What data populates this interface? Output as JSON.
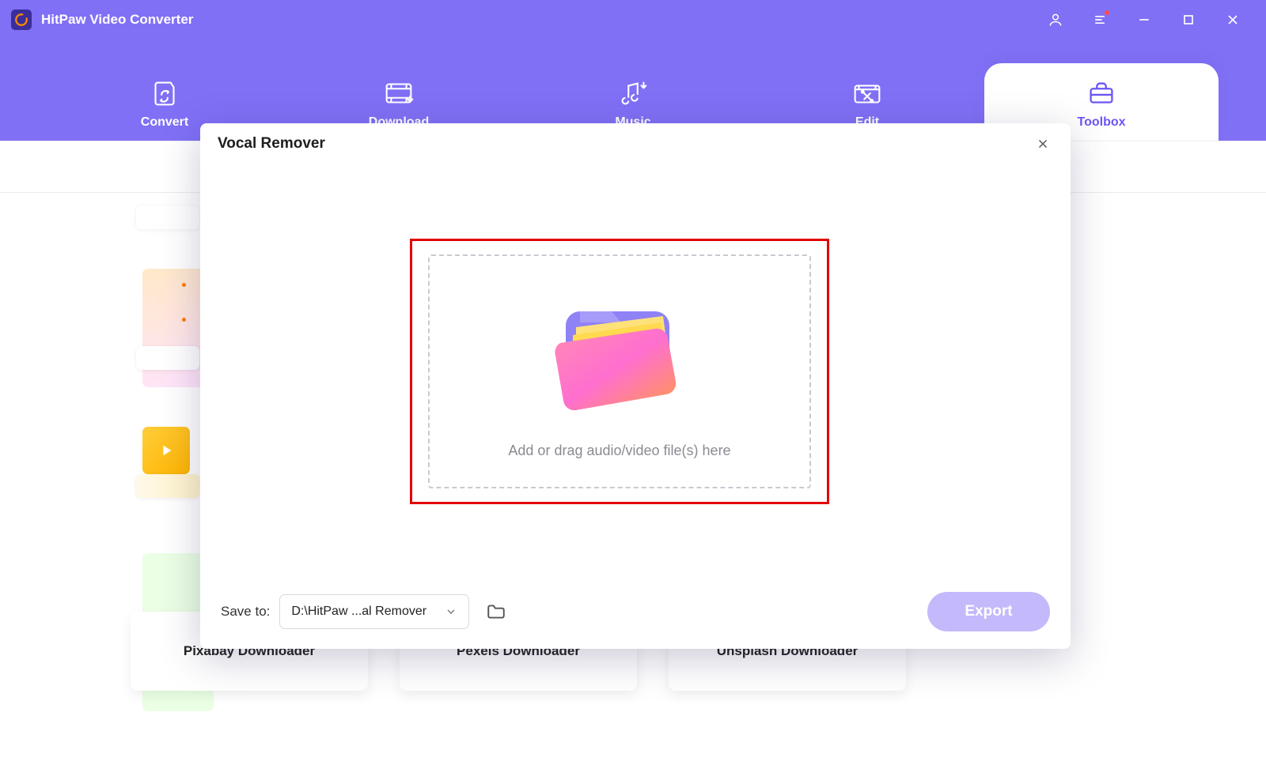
{
  "app": {
    "title": "HitPaw Video Converter"
  },
  "tabs": {
    "convert": {
      "label": "Convert"
    },
    "download": {
      "label": "Download"
    },
    "music": {
      "label": "Music"
    },
    "edit": {
      "label": "Edit"
    },
    "toolbox": {
      "label": "Toolbox"
    }
  },
  "bottomCards": {
    "pixabay": {
      "label": "Pixabay Downloader"
    },
    "pexels": {
      "label": "Pexels Downloader"
    },
    "unsplash": {
      "label": "Unsplash Downloader"
    }
  },
  "modal": {
    "title": "Vocal Remover",
    "dropText": "Add or drag audio/video file(s) here",
    "saveToLabel": "Save to:",
    "savePath": "D:\\HitPaw ...al Remover",
    "exportLabel": "Export"
  }
}
